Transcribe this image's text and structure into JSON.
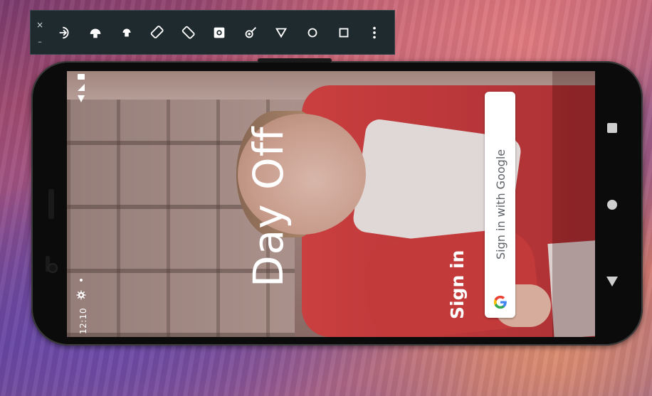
{
  "toolbar": {
    "close_glyph": "×",
    "minimize_glyph": "–",
    "buttons": [
      {
        "icon": "power-icon"
      },
      {
        "icon": "volume-up-icon"
      },
      {
        "icon": "volume-down-icon"
      },
      {
        "icon": "rotate-left-icon"
      },
      {
        "icon": "rotate-right-icon"
      },
      {
        "icon": "camera-icon"
      },
      {
        "icon": "zoom-icon"
      },
      {
        "icon": "back-icon"
      },
      {
        "icon": "home-icon"
      },
      {
        "icon": "overview-icon"
      },
      {
        "icon": "more-icon"
      }
    ]
  },
  "status_bar": {
    "time": "12:10"
  },
  "app": {
    "title": "Day Off",
    "sign_in_label": "Sign in",
    "google_button_label": "Sign in with Google"
  },
  "colors": {
    "shirt": "#d93b3b",
    "google_blue": "#4285F4",
    "google_red": "#EA4335",
    "google_yellow": "#FBBC05",
    "google_green": "#34A853",
    "toolbar_bg": "#1f2a2f"
  }
}
